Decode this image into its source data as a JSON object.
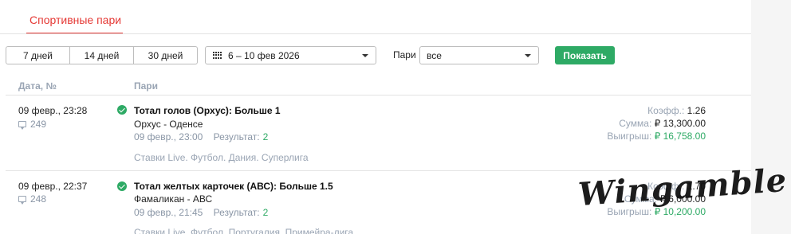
{
  "tab": {
    "label": "Спортивные пари"
  },
  "filters": {
    "periods": [
      "7 дней",
      "14 дней",
      "30 дней"
    ],
    "date_range": "6 – 10 фев 2026",
    "pari_label": "Пари",
    "pari_value": "все",
    "show_button": "Показать"
  },
  "columns": {
    "date": "Дата, №",
    "bets": "Пари"
  },
  "bets": [
    {
      "datetime": "09 февр., 23:28",
      "number": "249",
      "title": "Тотал голов (Орхус): Больше 1",
      "teams": "Орхус - Оденсе",
      "event_time": "09 февр., 23:00",
      "result_label": "Результат:",
      "result": "2",
      "league": "Ставки Live. Футбол. Дания. Суперлига",
      "coef_label": "Коэфф.:",
      "coef": "1.26",
      "sum_label": "Сумма:",
      "sum": "₽ 13,300.00",
      "win_label": "Выигрыш:",
      "win": "₽ 16,758.00"
    },
    {
      "datetime": "09 февр., 22:37",
      "number": "248",
      "title": "Тотал желтых карточек (АВС): Больше 1.5",
      "teams": "Фамаликан - АВС",
      "event_time": "09 февр., 21:45",
      "result_label": "Результат:",
      "result": "2",
      "league": "Ставки Live. Футбол. Португалия. Примейра-лига",
      "coef_label": "Коэфф.:",
      "coef": "1.70",
      "sum_label": "Сумма:",
      "sum": "₽ 6,000.00",
      "win_label": "Выигрыш:",
      "win": "₽ 10,200.00"
    }
  ],
  "watermark": "Wingamble",
  "colors": {
    "accent_red": "#e53935",
    "green": "#2eaa65",
    "muted": "#9aa5b4"
  }
}
